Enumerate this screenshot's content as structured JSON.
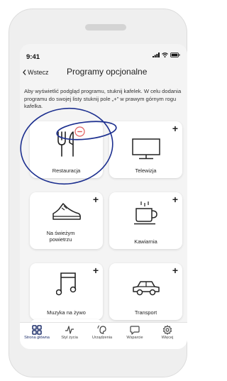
{
  "status": {
    "time": "9:41"
  },
  "header": {
    "back_label": "Wstecz",
    "title": "Programy opcjonalne"
  },
  "description": "Aby wyświetlić podgląd programu, stuknij kafelek. W celu dodania programu do swojej listy stuknij pole „+” w prawym górnym rogu kafelka.",
  "tiles": [
    {
      "label": "Restauracja",
      "icon": "cutlery-icon",
      "action": "remove"
    },
    {
      "label": "Telewizja",
      "icon": "tv-icon",
      "action": "add",
      "action_label": "+"
    },
    {
      "label": "Na świeżym powietrzu",
      "icon": "shoe-icon",
      "action": "add",
      "action_label": "+"
    },
    {
      "label": "Kawiarnia",
      "icon": "coffee-cup-icon",
      "action": "add",
      "action_label": "+"
    },
    {
      "label": "Muzyka na żywo",
      "icon": "music-note-icon",
      "action": "add",
      "action_label": "+"
    },
    {
      "label": "Transport",
      "icon": "car-icon",
      "action": "add",
      "action_label": "+"
    },
    {
      "label": "",
      "icon": "",
      "action": "add",
      "action_label": "+"
    }
  ],
  "tabs": [
    {
      "label": "Strona główna",
      "icon": "grid-icon",
      "active": true
    },
    {
      "label": "Styl życia",
      "icon": "activity-icon",
      "active": false
    },
    {
      "label": "Urządzenia",
      "icon": "hearing-aid-icon",
      "active": false
    },
    {
      "label": "Wsparcie",
      "icon": "chat-icon",
      "active": false
    },
    {
      "label": "Więcej",
      "icon": "gear-icon",
      "active": false
    }
  ],
  "colors": {
    "accent": "#1e2f6b",
    "remove": "#e05c5c",
    "annotation": "#1c2f8f"
  }
}
